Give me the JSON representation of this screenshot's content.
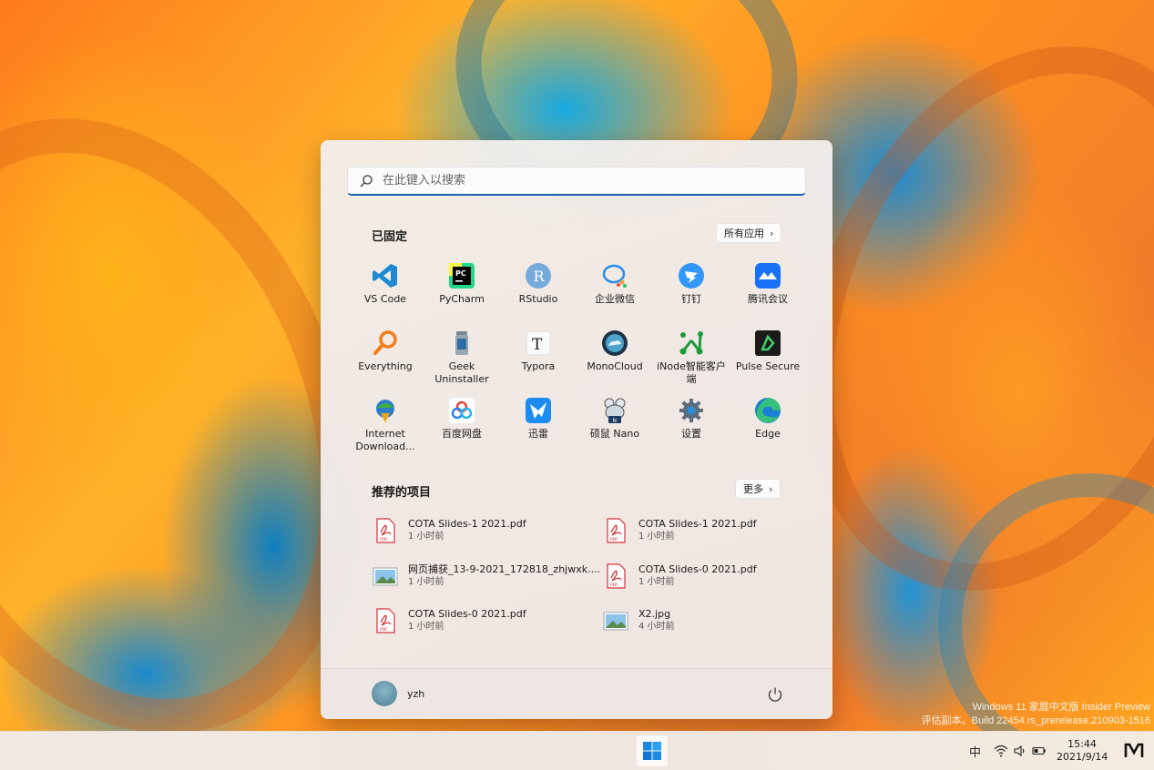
{
  "watermark": {
    "line1": "Windows 11 家庭中文版 Insider Preview",
    "line2": "评估副本。Build 22454.rs_prerelease.210903-1516"
  },
  "start_menu": {
    "search_placeholder": "在此键入以搜索",
    "pinned_title": "已固定",
    "all_apps_label": "所有应用",
    "pinned_apps": [
      {
        "label": "VS Code",
        "icon": "vscode-icon"
      },
      {
        "label": "PyCharm",
        "icon": "pycharm-icon"
      },
      {
        "label": "RStudio",
        "icon": "rstudio-icon"
      },
      {
        "label": "企业微信",
        "icon": "wecom-icon"
      },
      {
        "label": "钉钉",
        "icon": "dingtalk-icon"
      },
      {
        "label": "腾讯会议",
        "icon": "tencent-meeting-icon"
      },
      {
        "label": "Everything",
        "icon": "everything-icon"
      },
      {
        "label": "Geek Uninstaller",
        "icon": "geek-uninstaller-icon"
      },
      {
        "label": "Typora",
        "icon": "typora-icon"
      },
      {
        "label": "MonoCloud",
        "icon": "monocloud-icon"
      },
      {
        "label": "iNode智能客户端",
        "icon": "inode-icon"
      },
      {
        "label": "Pulse Secure",
        "icon": "pulse-secure-icon"
      },
      {
        "label": "Internet Download...",
        "icon": "idm-icon"
      },
      {
        "label": "百度网盘",
        "icon": "baidu-netdisk-icon"
      },
      {
        "label": "迅雷",
        "icon": "xunlei-icon"
      },
      {
        "label": "硕鼠 Nano",
        "icon": "shuoshu-nano-icon"
      },
      {
        "label": "设置",
        "icon": "settings-gear-icon"
      },
      {
        "label": "Edge",
        "icon": "edge-icon"
      }
    ],
    "recommended_title": "推荐的项目",
    "more_label": "更多",
    "recommended": [
      {
        "name": "COTA Slides-1 2021.pdf",
        "time": "1 小时前",
        "type": "pdf"
      },
      {
        "name": "COTA Slides-1 2021.pdf",
        "time": "1 小时前",
        "type": "pdf"
      },
      {
        "name": "网页捕获_13-9-2021_172818_zhjwxk....",
        "time": "1 小时前",
        "type": "image"
      },
      {
        "name": "COTA Slides-0 2021.pdf",
        "time": "1 小时前",
        "type": "pdf"
      },
      {
        "name": "COTA Slides-0 2021.pdf",
        "time": "1 小时前",
        "type": "pdf"
      },
      {
        "name": "X2.jpg",
        "time": "4 小时前",
        "type": "image"
      }
    ],
    "user_name": "yzh"
  },
  "taskbar": {
    "ime": "中",
    "time": "15:44",
    "date": "2021/9/14"
  },
  "colors": {
    "accent": "#1b5fb0",
    "pdf_red": "#d13438"
  }
}
